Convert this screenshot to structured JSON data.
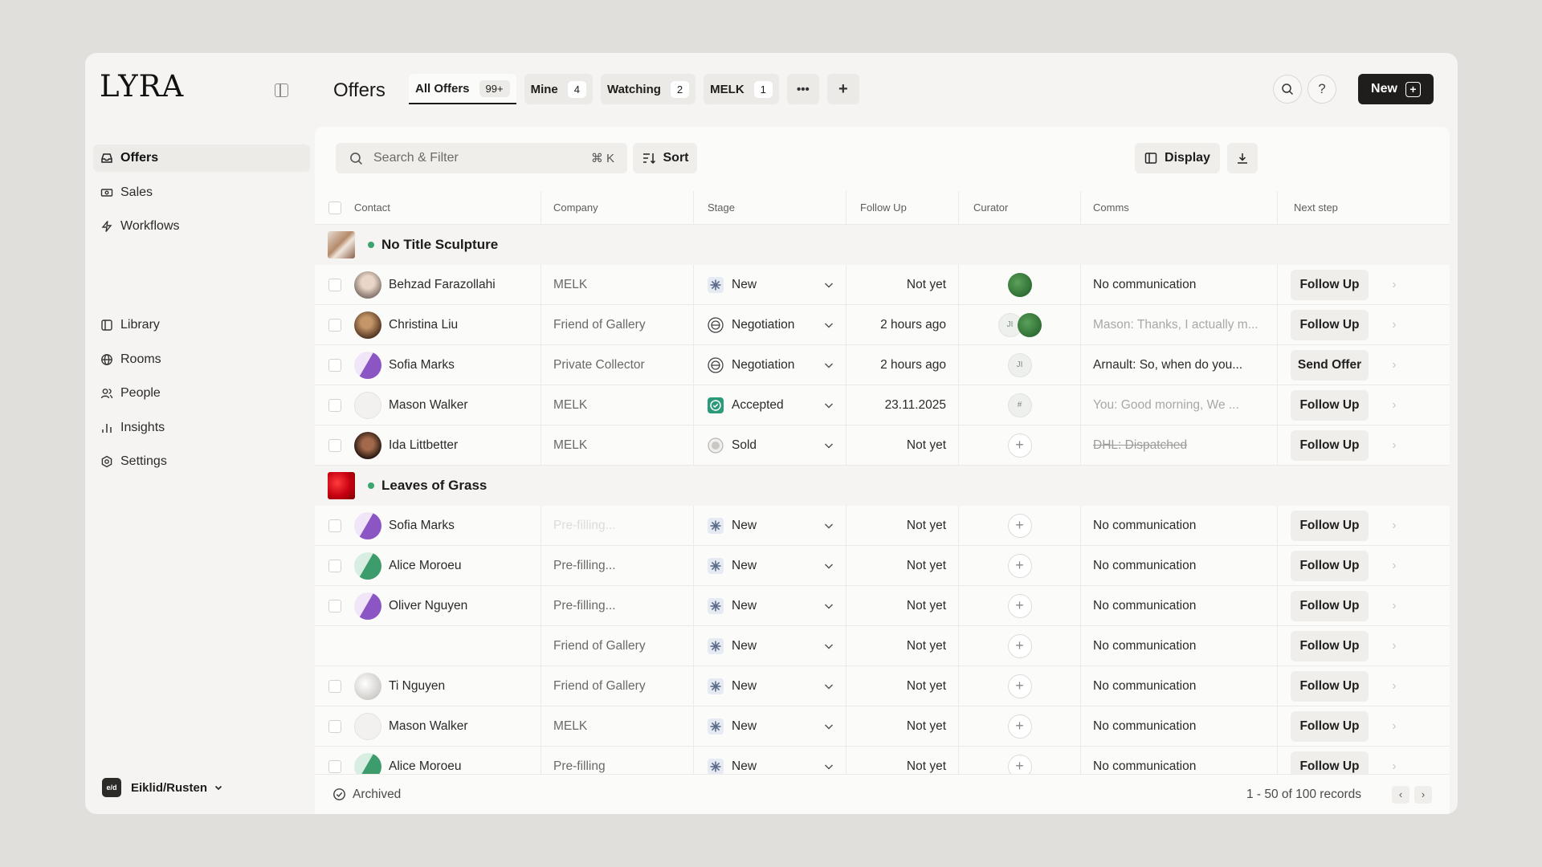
{
  "app": {
    "logo": "LYRA"
  },
  "sidebar": {
    "items": [
      {
        "label": "Offers",
        "icon": "offers-icon",
        "active": true
      },
      {
        "label": "Sales",
        "icon": "sales-icon"
      },
      {
        "label": "Workflows",
        "icon": "workflows-icon"
      },
      {
        "label": "Library",
        "icon": "library-icon"
      },
      {
        "label": "Rooms",
        "icon": "rooms-icon"
      },
      {
        "label": "People",
        "icon": "people-icon"
      },
      {
        "label": "Insights",
        "icon": "insights-icon"
      },
      {
        "label": "Settings",
        "icon": "settings-icon"
      }
    ],
    "workspace": {
      "name": "Eiklid/Rusten",
      "avatar_text": "e/d"
    }
  },
  "header": {
    "title": "Offers",
    "tabs": [
      {
        "label": "All Offers",
        "count": "99+",
        "active": true
      },
      {
        "label": "Mine",
        "count": "4"
      },
      {
        "label": "Watching",
        "count": "2"
      },
      {
        "label": "MELK",
        "count": "1"
      }
    ],
    "more_label": "•••",
    "add_label": "+",
    "help_label": "?",
    "new_label": "New"
  },
  "toolbar": {
    "search_placeholder": "Search & Filter",
    "search_shortcut": "⌘ K",
    "sort_label": "Sort",
    "display_label": "Display"
  },
  "table": {
    "columns": [
      "Contact",
      "Company",
      "Stage",
      "Follow Up",
      "Curator",
      "Comms",
      "Next step"
    ],
    "groups": [
      {
        "title": "No Title Sculpture",
        "rows": [
          {
            "contact": "Behzad Farazollahi",
            "company": "MELK",
            "stage": "New",
            "follow_up": "Not yet",
            "curator": "green",
            "comms": "No communication",
            "next": "Follow Up"
          },
          {
            "contact": "Christina Liu",
            "company": "Friend of Gallery",
            "stage": "Negotiation",
            "follow_up": "2 hours ago",
            "curator": "JI+green",
            "curator_initials": "JI",
            "comms": "Mason: Thanks, I actually m...",
            "next": "Follow Up"
          },
          {
            "contact": "Sofia Marks",
            "company": "Private Collector",
            "stage": "Negotiation",
            "follow_up": "2 hours ago",
            "curator": "JI",
            "curator_initials": "JI",
            "comms": "Arnault: So, when do you...",
            "next": "Send Offer"
          },
          {
            "contact": "Mason Walker",
            "company": "MELK",
            "stage": "Accepted",
            "follow_up": "23.11.2025",
            "curator": "hash",
            "curator_initials": "#",
            "comms": "You: Good morning, We ...",
            "next": "Follow Up"
          },
          {
            "contact": "Ida Littbetter",
            "company": "MELK",
            "stage": "Sold",
            "follow_up": "Not yet",
            "curator": "plus",
            "comms": "DHL: Dispatched",
            "next": "Follow Up"
          }
        ]
      },
      {
        "title": "Leaves of Grass",
        "rows": [
          {
            "contact": "Sofia Marks",
            "company": "Pre-filling...",
            "stage": "New",
            "follow_up": "Not yet",
            "curator": "plus",
            "comms": "No communication",
            "next": "Follow Up"
          },
          {
            "contact": "Alice Moroeu",
            "company": "Pre-filling...",
            "stage": "New",
            "follow_up": "Not yet",
            "curator": "plus",
            "comms": "No communication",
            "next": "Follow Up"
          },
          {
            "contact": "Oliver Nguyen",
            "company": "Pre-filling...",
            "stage": "New",
            "follow_up": "Not yet",
            "curator": "plus",
            "comms": "No communication",
            "next": "Follow Up"
          },
          {
            "contact": "",
            "company": "Friend of Gallery",
            "stage": "New",
            "follow_up": "Not yet",
            "curator": "plus",
            "comms": "No communication",
            "next": "Follow Up"
          },
          {
            "contact": "Ti Nguyen",
            "company": "Friend of Gallery",
            "stage": "New",
            "follow_up": "Not yet",
            "curator": "plus",
            "comms": "No communication",
            "next": "Follow Up"
          },
          {
            "contact": "Mason Walker",
            "company": "MELK",
            "stage": "New",
            "follow_up": "Not yet",
            "curator": "plus",
            "comms": "No communication",
            "next": "Follow Up"
          },
          {
            "contact": "Alice Moroeu",
            "company": "Pre-filling",
            "stage": "New",
            "follow_up": "Not yet",
            "curator": "plus",
            "comms": "No communication",
            "next": "Follow Up"
          }
        ]
      }
    ]
  },
  "footer": {
    "archived_label": "Archived",
    "records_label": "1 - 50 of 100 records"
  },
  "colors": {
    "accent_dark": "#1f1e1c",
    "status_green": "#3aa56d",
    "accepted_teal": "#2b9a7a"
  }
}
